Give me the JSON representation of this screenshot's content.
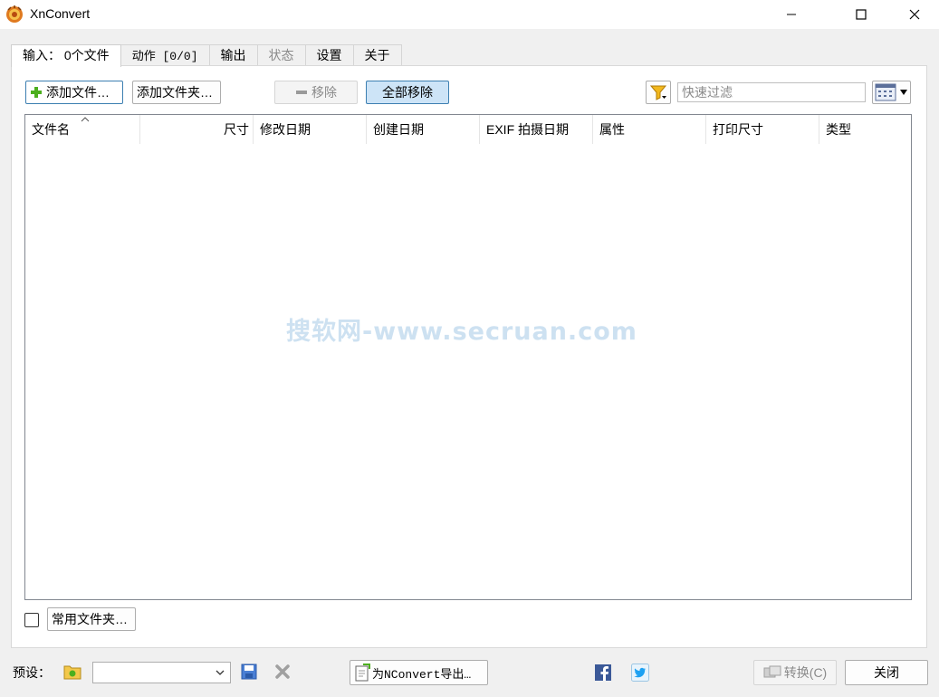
{
  "window": {
    "title": "XnConvert"
  },
  "tabs": [
    {
      "label": "输入： 0个文件"
    },
    {
      "label": "动作 [0/0]"
    },
    {
      "label": "输出"
    },
    {
      "label": "状态"
    },
    {
      "label": "设置"
    },
    {
      "label": "关于"
    }
  ],
  "toolbar": {
    "add_files": "添加文件…",
    "add_folder": "添加文件夹…",
    "remove": "移除",
    "remove_all": "全部移除",
    "filter_placeholder": "快速过滤"
  },
  "columns": [
    {
      "label": "文件名"
    },
    {
      "label": "尺寸"
    },
    {
      "label": "修改日期"
    },
    {
      "label": "创建日期"
    },
    {
      "label": "EXIF 拍摄日期"
    },
    {
      "label": "属性"
    },
    {
      "label": "打印尺寸"
    },
    {
      "label": "类型"
    }
  ],
  "watermark": "搜软网-www.secruan.com",
  "favorites_button": "常用文件夹…",
  "bottom": {
    "preset_label": "预设：",
    "preset_value": "",
    "export_button": "为NConvert导出…",
    "convert_button": "转换(C)",
    "close_button": "关闭"
  },
  "colors": {
    "accent_border": "#3c7fb1",
    "accent_fill": "#cde4f7",
    "facebook": "#3b5998",
    "twitter": "#1da1f2"
  }
}
